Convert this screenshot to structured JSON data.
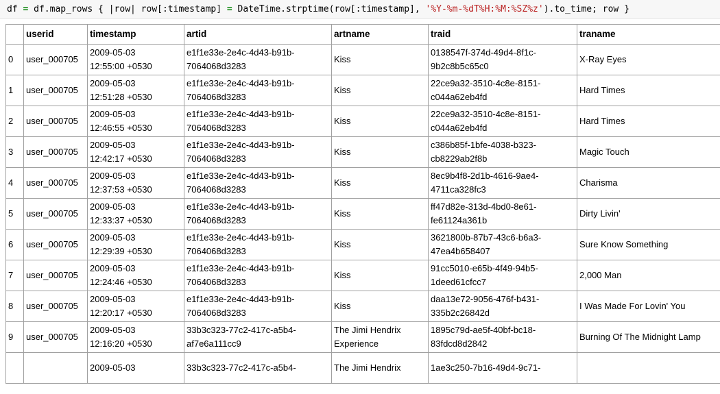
{
  "code": {
    "line_parts": [
      {
        "t": "df ",
        "k": "tk"
      },
      {
        "t": "=",
        "k": "kw"
      },
      {
        "t": " df.map_rows { |row| row[:timestamp] ",
        "k": "tk"
      },
      {
        "t": "=",
        "k": "kw"
      },
      {
        "t": " DateTime.strptime(row[:timestamp], ",
        "k": "tk"
      },
      {
        "t": "'%Y-%m-%dT%H:%M:%SZ%z'",
        "k": "str"
      },
      {
        "t": ").to_time; row }",
        "k": "tk"
      }
    ]
  },
  "table": {
    "columns": [
      "",
      "userid",
      "timestamp",
      "artid",
      "artname",
      "traid",
      "traname"
    ],
    "rows": [
      {
        "idx": "0",
        "userid": "user_000705",
        "timestamp": [
          "2009-05-03",
          "12:55:00 +0530"
        ],
        "artid": [
          "e1f1e33e-2e4c-4d43-b91b-",
          "7064068d3283"
        ],
        "artname": [
          "Kiss"
        ],
        "traid": [
          "0138547f-374d-49d4-8f1c-",
          "9b2c8b5c65c0"
        ],
        "traname": "X-Ray Eyes"
      },
      {
        "idx": "1",
        "userid": "user_000705",
        "timestamp": [
          "2009-05-03",
          "12:51:28 +0530"
        ],
        "artid": [
          "e1f1e33e-2e4c-4d43-b91b-",
          "7064068d3283"
        ],
        "artname": [
          "Kiss"
        ],
        "traid": [
          "22ce9a32-3510-4c8e-8151-",
          "c044a62eb4fd"
        ],
        "traname": "Hard Times"
      },
      {
        "idx": "2",
        "userid": "user_000705",
        "timestamp": [
          "2009-05-03",
          "12:46:55 +0530"
        ],
        "artid": [
          "e1f1e33e-2e4c-4d43-b91b-",
          "7064068d3283"
        ],
        "artname": [
          "Kiss"
        ],
        "traid": [
          "22ce9a32-3510-4c8e-8151-",
          "c044a62eb4fd"
        ],
        "traname": "Hard Times"
      },
      {
        "idx": "3",
        "userid": "user_000705",
        "timestamp": [
          "2009-05-03",
          "12:42:17 +0530"
        ],
        "artid": [
          "e1f1e33e-2e4c-4d43-b91b-",
          "7064068d3283"
        ],
        "artname": [
          "Kiss"
        ],
        "traid": [
          "c386b85f-1bfe-4038-b323-",
          "cb8229ab2f8b"
        ],
        "traname": "Magic Touch"
      },
      {
        "idx": "4",
        "userid": "user_000705",
        "timestamp": [
          "2009-05-03",
          "12:37:53 +0530"
        ],
        "artid": [
          "e1f1e33e-2e4c-4d43-b91b-",
          "7064068d3283"
        ],
        "artname": [
          "Kiss"
        ],
        "traid": [
          "8ec9b4f8-2d1b-4616-9ae4-",
          "4711ca328fc3"
        ],
        "traname": "Charisma"
      },
      {
        "idx": "5",
        "userid": "user_000705",
        "timestamp": [
          "2009-05-03",
          "12:33:37 +0530"
        ],
        "artid": [
          "e1f1e33e-2e4c-4d43-b91b-",
          "7064068d3283"
        ],
        "artname": [
          "Kiss"
        ],
        "traid": [
          "ff47d82e-313d-4bd0-8e61-",
          "fe61124a361b"
        ],
        "traname": "Dirty Livin'"
      },
      {
        "idx": "6",
        "userid": "user_000705",
        "timestamp": [
          "2009-05-03",
          "12:29:39 +0530"
        ],
        "artid": [
          "e1f1e33e-2e4c-4d43-b91b-",
          "7064068d3283"
        ],
        "artname": [
          "Kiss"
        ],
        "traid": [
          "3621800b-87b7-43c6-b6a3-",
          "47ea4b658407"
        ],
        "traname": "Sure Know Something"
      },
      {
        "idx": "7",
        "userid": "user_000705",
        "timestamp": [
          "2009-05-03",
          "12:24:46 +0530"
        ],
        "artid": [
          "e1f1e33e-2e4c-4d43-b91b-",
          "7064068d3283"
        ],
        "artname": [
          "Kiss"
        ],
        "traid": [
          "91cc5010-e65b-4f49-94b5-",
          "1deed61cfcc7"
        ],
        "traname": "2,000 Man"
      },
      {
        "idx": "8",
        "userid": "user_000705",
        "timestamp": [
          "2009-05-03",
          "12:20:17 +0530"
        ],
        "artid": [
          "e1f1e33e-2e4c-4d43-b91b-",
          "7064068d3283"
        ],
        "artname": [
          "Kiss"
        ],
        "traid": [
          "daa13e72-9056-476f-b431-",
          "335b2c26842d"
        ],
        "traname": "I Was Made For Lovin' You"
      },
      {
        "idx": "9",
        "userid": "user_000705",
        "timestamp": [
          "2009-05-03",
          "12:16:20 +0530"
        ],
        "artid": [
          "33b3c323-77c2-417c-a5b4-",
          "af7e6a111cc9"
        ],
        "artname": [
          "The Jimi Hendrix",
          "Experience"
        ],
        "traid": [
          "1895c79d-ae5f-40bf-bc18-",
          "83fdcd8d2842"
        ],
        "traname": "Burning Of The Midnight Lamp"
      }
    ],
    "partial_row": {
      "timestamp": "2009-05-03",
      "artid": "33b3c323-77c2-417c-a5b4-",
      "artname": "The Jimi Hendrix",
      "traid": "1ae3c250-7b16-49d4-9c71-"
    }
  }
}
